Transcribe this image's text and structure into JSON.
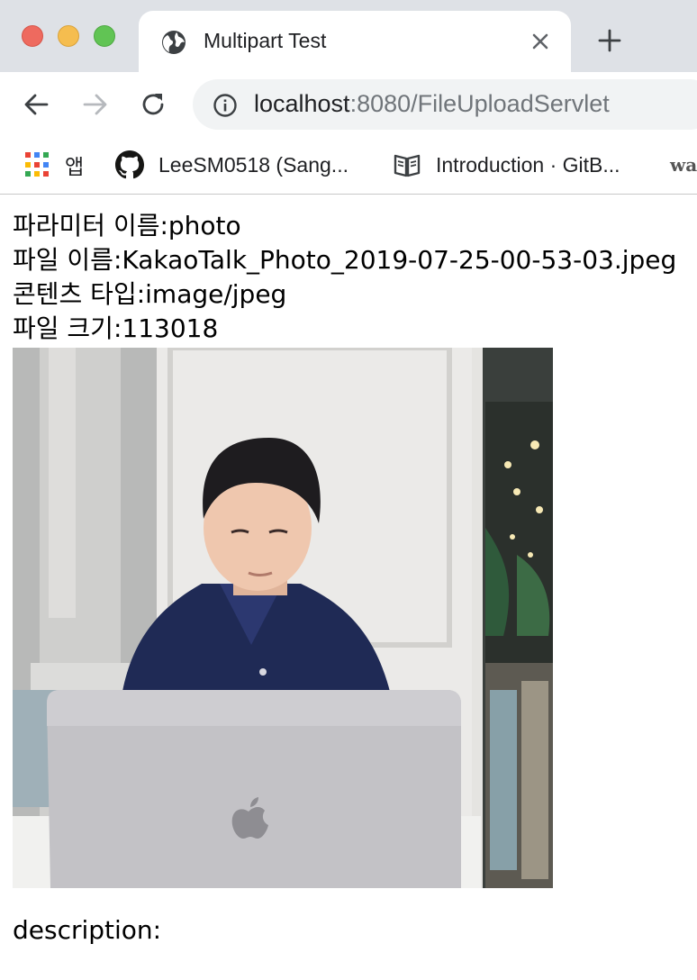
{
  "browser": {
    "tab": {
      "title": "Multipart Test"
    },
    "address_bar": {
      "host": "localhost",
      "path": ":8080/FileUploadServlet"
    },
    "bookmarks": [
      {
        "label": "앱",
        "icon": "apps-grid-icon"
      },
      {
        "label": "LeeSM0518 (Sang...",
        "icon": "github-icon"
      },
      {
        "label": "Introduction · GitB...",
        "icon": "gitbook-icon"
      },
      {
        "label": "wa",
        "icon": "bookmark-favicon"
      }
    ]
  },
  "page": {
    "lines": [
      "파라미터 이름:photo",
      "파일 이름:KakaoTalk_Photo_2019-07-25-00-53-03.jpeg",
      "콘텐츠 타입:image/jpeg",
      "파일 크기:113018"
    ],
    "description": "description:"
  },
  "colors": {
    "tabstrip_bg": "#dee1e6",
    "omnibox_bg": "#f1f3f4",
    "traffic_close": "#ee6a5f",
    "traffic_min": "#f5bd4f",
    "traffic_max": "#61c454"
  }
}
